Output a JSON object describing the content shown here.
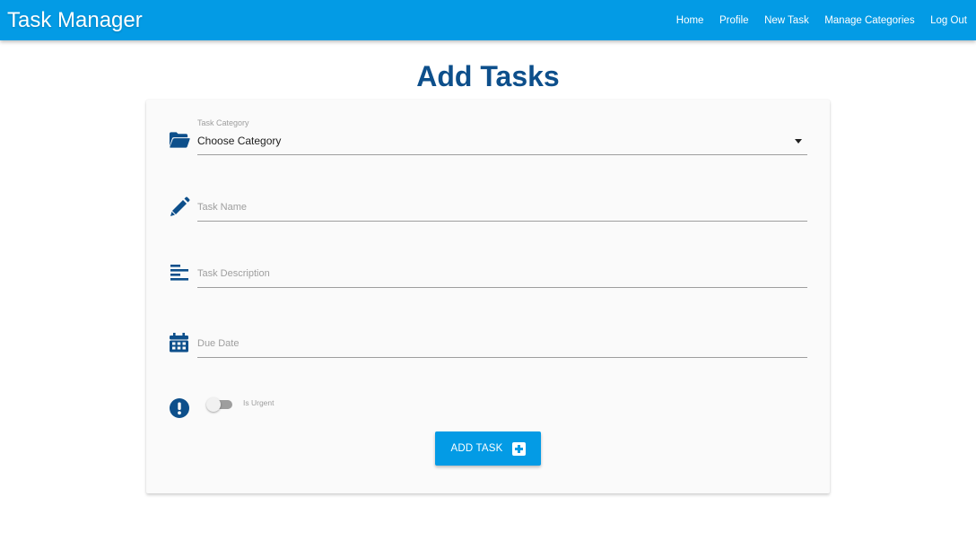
{
  "app": {
    "title": "Task Manager"
  },
  "nav": {
    "items": [
      {
        "label": "Home"
      },
      {
        "label": "Profile"
      },
      {
        "label": "New Task"
      },
      {
        "label": "Manage Categories"
      },
      {
        "label": "Log Out"
      }
    ]
  },
  "page": {
    "title": "Add Tasks"
  },
  "form": {
    "category": {
      "label": "Task Category",
      "value": "Choose Category",
      "icon": "folder-open-icon"
    },
    "task_name": {
      "placeholder": "Task Name",
      "value": "",
      "icon": "pencil-icon"
    },
    "task_description": {
      "placeholder": "Task Description",
      "value": "",
      "icon": "align-left-icon"
    },
    "due_date": {
      "placeholder": "Due Date",
      "value": "",
      "icon": "calendar-icon"
    },
    "urgent": {
      "label": "Is Urgent",
      "checked": false,
      "icon": "exclamation-circle-icon"
    },
    "submit": {
      "label": "ADD TASK",
      "icon": "plus-square-icon"
    }
  },
  "colors": {
    "primary": "#039be5",
    "icon": "#0d4f8b",
    "title": "#0d4f8b"
  }
}
